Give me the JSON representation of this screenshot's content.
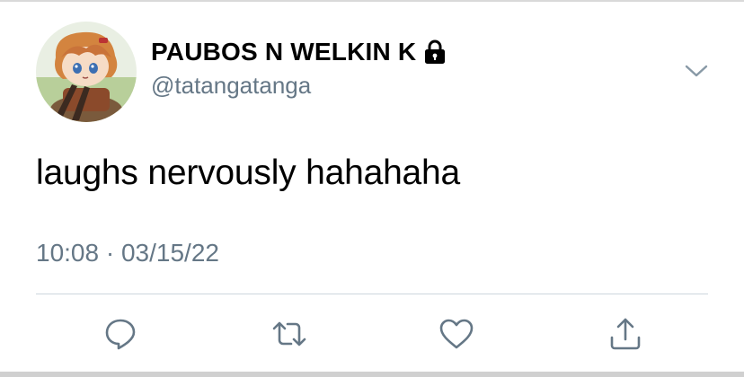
{
  "tweet": {
    "display_name": "PAUBOS N WELKIN K",
    "handle": "@tatangatanga",
    "text": "laughs nervously hahahaha",
    "time": "10:08",
    "separator": "·",
    "date": "03/15/22",
    "protected_icon": "lock-icon",
    "menu_icon": "chevron-down-icon"
  },
  "actions": [
    {
      "icon": "reply-icon"
    },
    {
      "icon": "retweet-icon"
    },
    {
      "icon": "like-icon"
    },
    {
      "icon": "share-icon"
    }
  ],
  "colors": {
    "text": "#000000",
    "secondary": "#657786",
    "divider": "#ccd6dd",
    "icon": "#657786"
  }
}
